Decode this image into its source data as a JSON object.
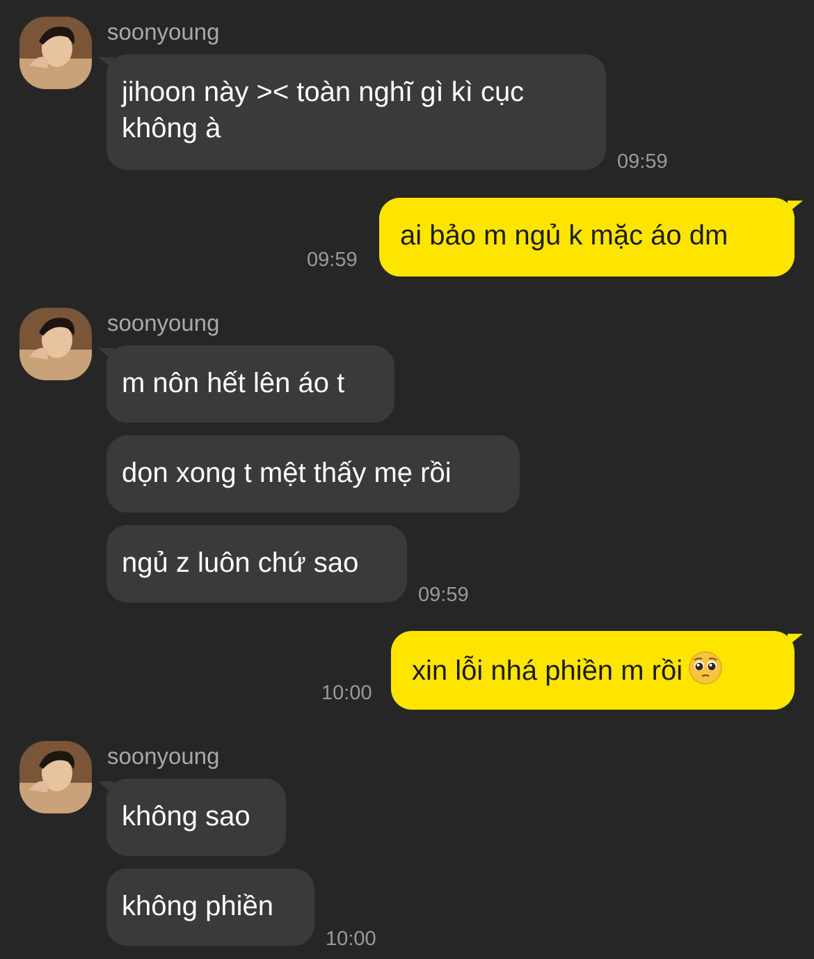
{
  "chat": {
    "groups": [
      {
        "sender": "soonyoung",
        "messages": [
          {
            "text_line1": "jihoon này >< toàn nghĩ gì kì cục",
            "text_line2": "không à"
          }
        ],
        "time": "09:59"
      },
      {
        "outgoing": true,
        "messages": [
          {
            "text": "ai bảo m ngủ k mặc áo dm"
          }
        ],
        "time": "09:59"
      },
      {
        "sender": "soonyoung",
        "messages": [
          {
            "text": "m nôn hết lên áo t"
          },
          {
            "text": "dọn xong t mệt thấy mẹ rồi"
          },
          {
            "text": "ngủ z luôn chứ sao"
          }
        ],
        "time": "09:59"
      },
      {
        "outgoing": true,
        "messages": [
          {
            "text": "xin lỗi nhá phiền m rồi",
            "emoji": "pleading-face-emoji"
          }
        ],
        "time": "10:00"
      },
      {
        "sender": "soonyoung",
        "messages": [
          {
            "text": "không sao"
          },
          {
            "text": "không phiền"
          }
        ],
        "time": "10:00"
      }
    ]
  },
  "colors": {
    "background": "#262626",
    "incoming_bubble": "#3a3a3a",
    "outgoing_bubble": "#fee500",
    "timestamp": "#9a9a9a"
  }
}
